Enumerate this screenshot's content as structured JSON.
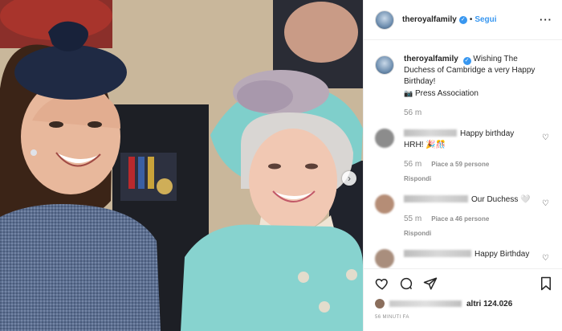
{
  "post": {
    "photo": {
      "subject": "Two women smiling at an outdoor event"
    }
  },
  "header": {
    "username": "theroyalfamily",
    "separator": "•",
    "follow_label": "Segui",
    "more_label": "···"
  },
  "caption": {
    "username": "theroyalfamily",
    "text": "Wishing The Duchess of Cambridge a very Happy Birthday!",
    "credit_icon": "📷",
    "credit": "Press Association",
    "time": "56 m"
  },
  "comments": [
    {
      "text": "Happy birthday HRH! 🎉🎊",
      "time": "56 m",
      "likes": "Piace a 59 persone",
      "reply": "Rispondi",
      "avatar_color": "#8c8c8c"
    },
    {
      "text": "Our Duchess 🤍",
      "time": "55 m",
      "likes": "Piace a 46 persone",
      "reply": "Rispondi",
      "avatar_color": "#b58d76"
    },
    {
      "text": "Happy Birthday",
      "avatar_color": "#a98e7d"
    }
  ],
  "actions": {
    "like_icon": "heart-icon",
    "comment_icon": "comment-icon",
    "share_icon": "share-icon",
    "save_icon": "bookmark-icon",
    "likes_summary": "altri 124.026",
    "timestamp": "56 MINUTI FA"
  },
  "colors": {
    "link_blue": "#3897f0",
    "muted_gray": "#8e8e8e",
    "text": "#262626",
    "divider": "#efefef"
  }
}
